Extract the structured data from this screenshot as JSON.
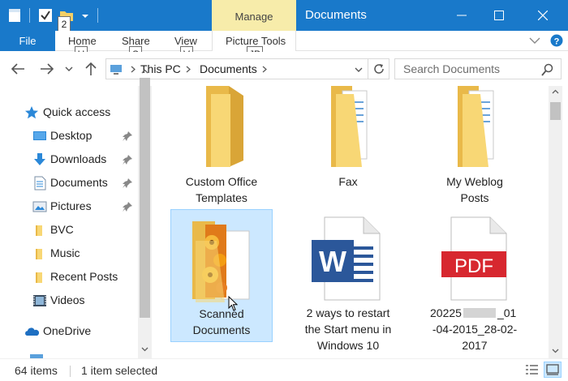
{
  "window": {
    "title": "Documents",
    "contextual_tab": "Manage",
    "accent": "#1979ca",
    "contextual_color": "#f7ecaa",
    "minimize_icon": "minimize-icon",
    "maximize_icon": "maximize-icon",
    "close_icon": "close-icon"
  },
  "quick_access_toolbar": {
    "keytip": "2"
  },
  "ribbon": {
    "file_label": "File",
    "tabs": [
      {
        "label": "Home",
        "keytip": "H"
      },
      {
        "label": "Share",
        "keytip": "S"
      },
      {
        "label": "View",
        "keytip": "V"
      },
      {
        "label": "Picture Tools",
        "keytip": "JP"
      }
    ]
  },
  "navbar": {
    "breadcrumb": [
      "This PC",
      "Documents"
    ],
    "search_placeholder": "Search Documents"
  },
  "sidebar": {
    "items": [
      {
        "label": "Quick access",
        "icon": "star-icon",
        "pinned": false
      },
      {
        "label": "Desktop",
        "icon": "desktop-icon",
        "pinned": true
      },
      {
        "label": "Downloads",
        "icon": "downloads-icon",
        "pinned": true
      },
      {
        "label": "Documents",
        "icon": "documents-icon",
        "pinned": true
      },
      {
        "label": "Pictures",
        "icon": "pictures-icon",
        "pinned": true
      },
      {
        "label": "BVC",
        "icon": "folder-icon",
        "pinned": false
      },
      {
        "label": "Music",
        "icon": "music-folder-icon",
        "pinned": false
      },
      {
        "label": "Recent Posts",
        "icon": "folder-icon",
        "pinned": false
      },
      {
        "label": "Videos",
        "icon": "videos-icon",
        "pinned": false
      },
      {
        "label": "OneDrive",
        "icon": "onedrive-icon",
        "pinned": false
      }
    ]
  },
  "files": [
    {
      "name_lines": [
        "Custom Office",
        "Templates"
      ],
      "type": "folder",
      "selected": false
    },
    {
      "name_lines": [
        "Fax"
      ],
      "type": "folder-docs",
      "selected": false
    },
    {
      "name_lines": [
        "My Weblog",
        "Posts"
      ],
      "type": "folder-docs",
      "selected": false
    },
    {
      "name_lines": [
        "Scanned",
        "Documents"
      ],
      "type": "folder-image",
      "selected": true
    },
    {
      "name_lines": [
        "2 ways to restart",
        "the Start menu in",
        "Windows 10"
      ],
      "type": "word",
      "selected": false
    },
    {
      "name_lines": [
        "20225",
        "_01",
        "-04-2015_28-02-",
        "2017"
      ],
      "type": "pdf",
      "selected": false
    }
  ],
  "status": {
    "item_count": "64 items",
    "selection": "1 item selected"
  },
  "badges": {
    "word_letter": "W",
    "pdf_label": "PDF"
  }
}
